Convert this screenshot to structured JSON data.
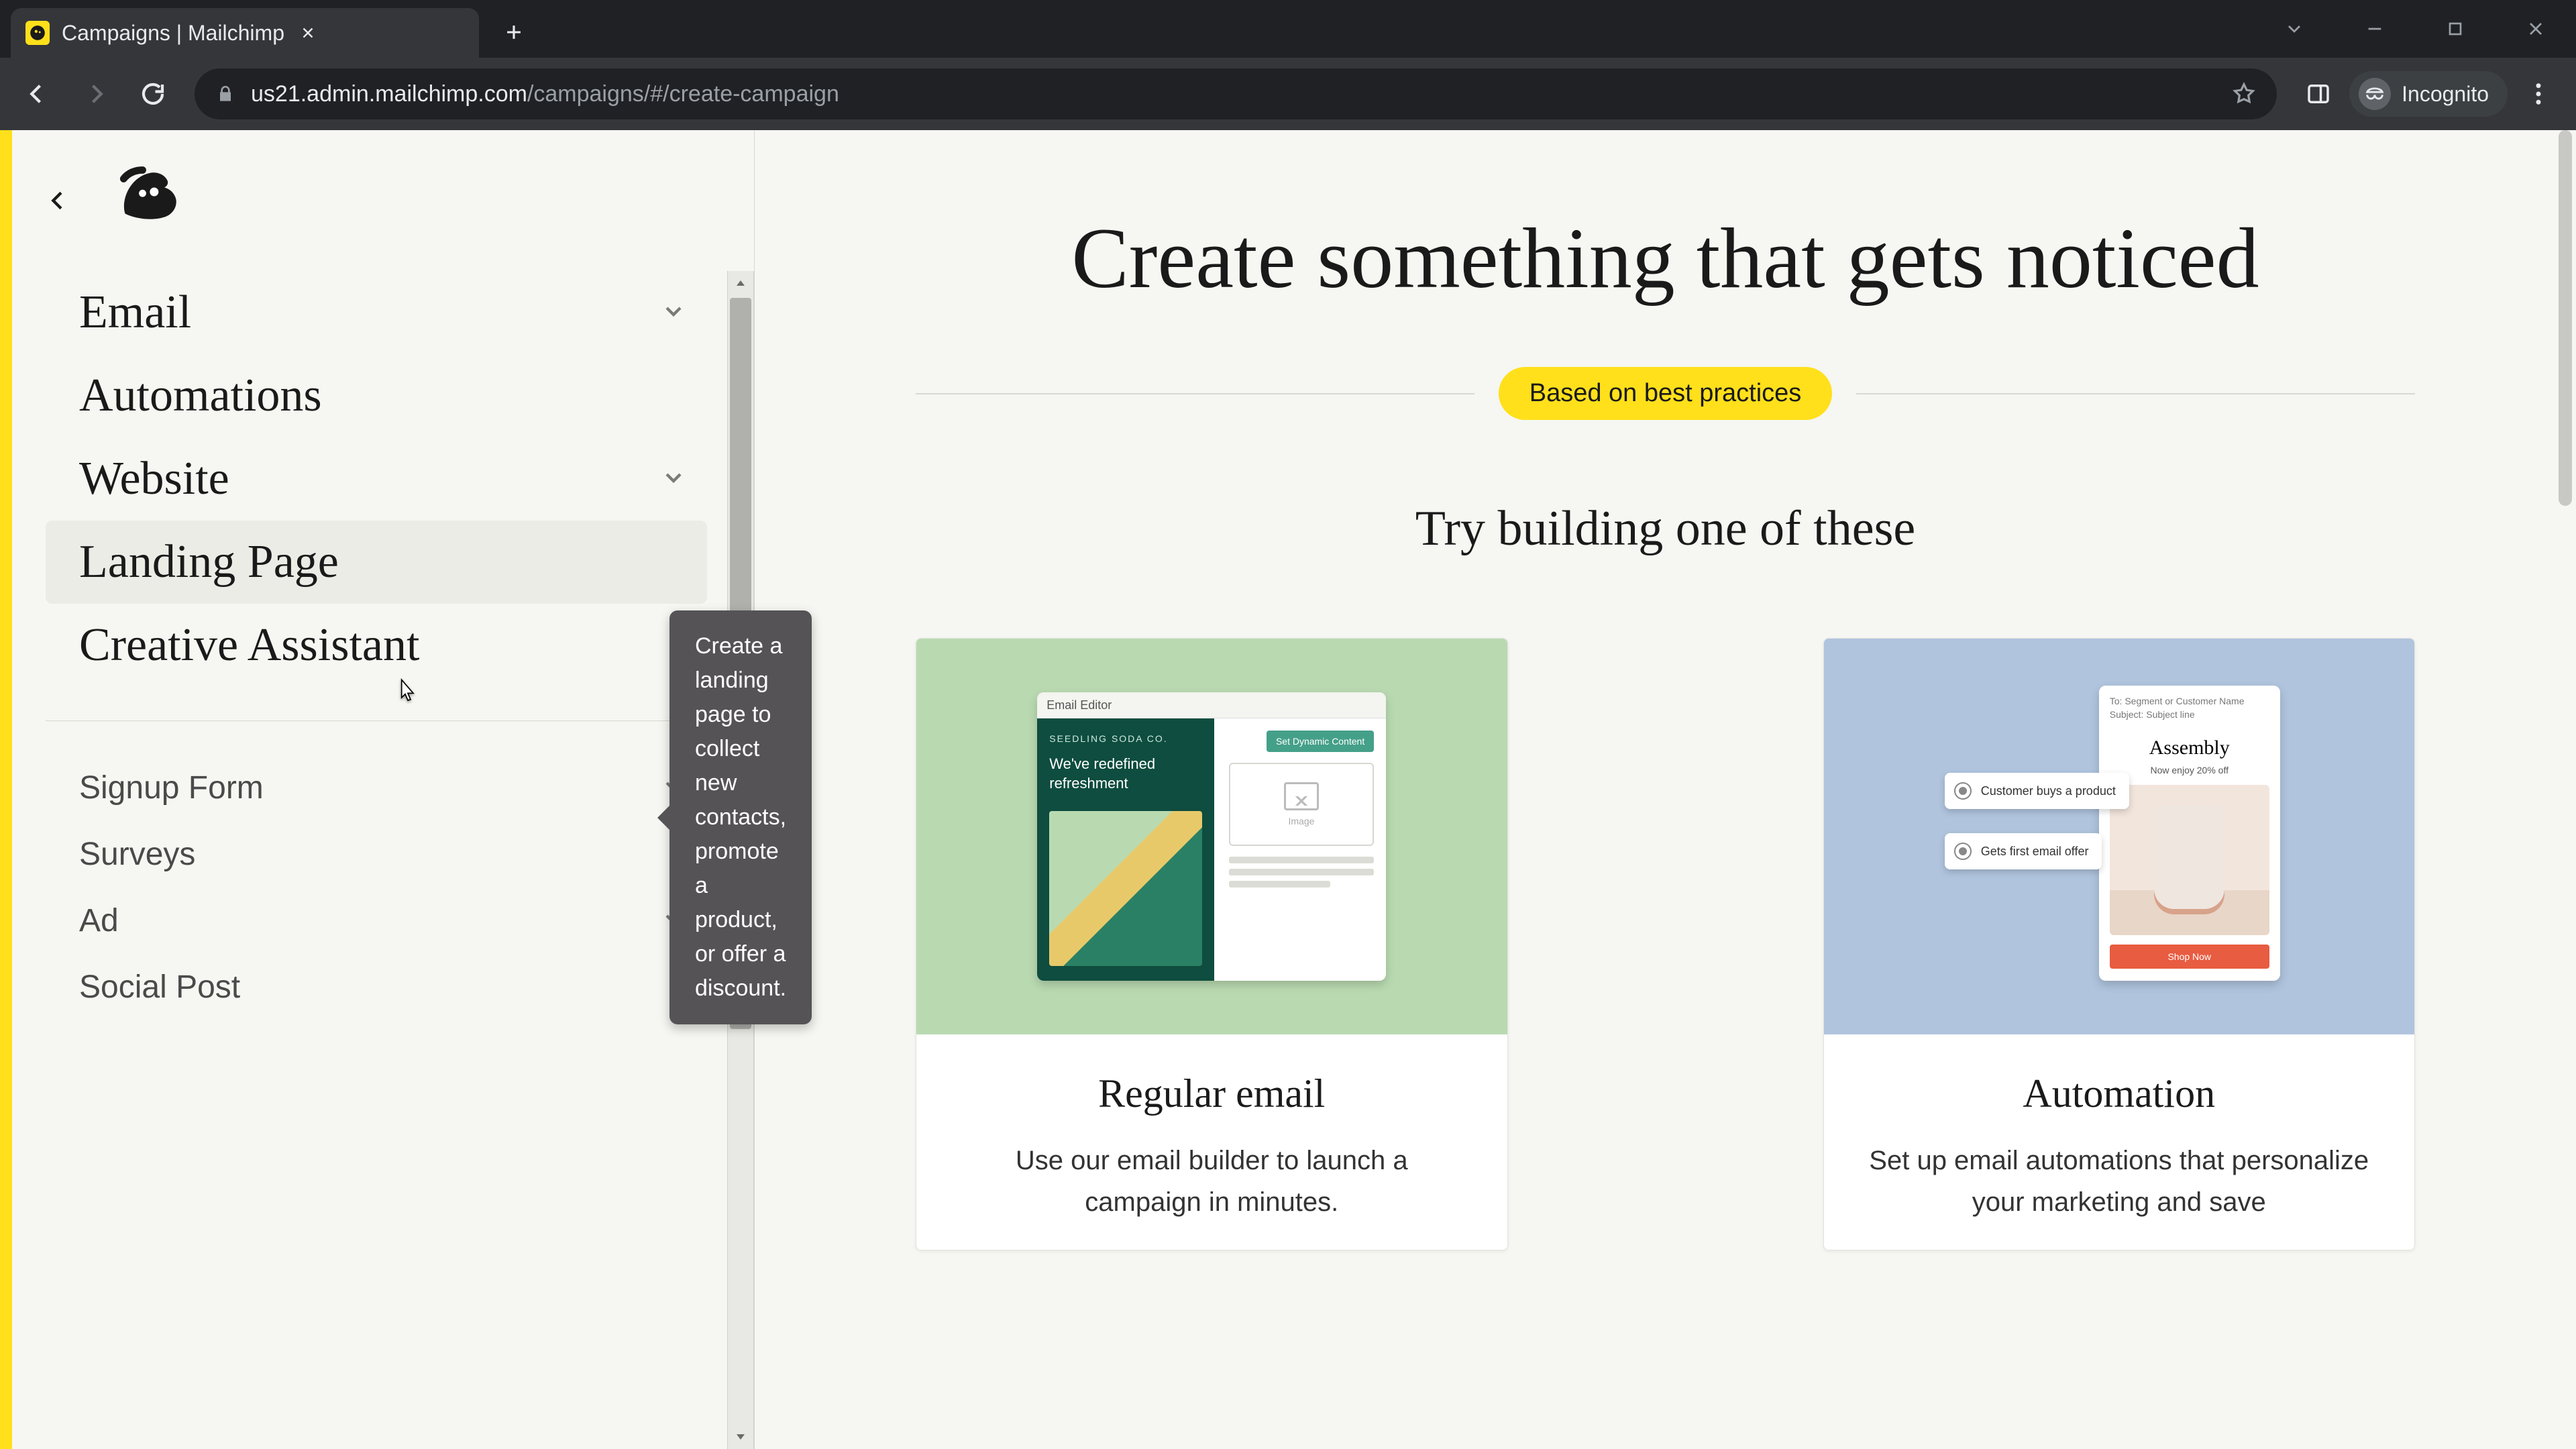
{
  "browser": {
    "tab_title": "Campaigns | Mailchimp",
    "url_host": "us21.admin.mailchimp.com",
    "url_path": "/campaigns/#/create-campaign",
    "incognito_label": "Incognito"
  },
  "sidebar": {
    "primary": [
      {
        "label": "Email",
        "expandable": true
      },
      {
        "label": "Automations",
        "expandable": false
      },
      {
        "label": "Website",
        "expandable": true
      },
      {
        "label": "Landing Page",
        "expandable": false,
        "hover": true
      },
      {
        "label": "Creative Assistant",
        "expandable": false
      }
    ],
    "secondary": [
      {
        "label": "Signup Form",
        "expandable": true
      },
      {
        "label": "Surveys",
        "expandable": false
      },
      {
        "label": "Ad",
        "expandable": true
      },
      {
        "label": "Social Post",
        "expandable": false
      }
    ]
  },
  "tooltip": {
    "text": "Create a landing page to collect new contacts, promote a product, or offer a discount."
  },
  "main": {
    "headline": "Create something that gets noticed",
    "pill": "Based on best practices",
    "subhead": "Try building one of these",
    "cards": [
      {
        "title": "Regular email",
        "desc": "Use our email builder to launch a campaign in minutes.",
        "mini": {
          "header": "Email Editor",
          "brand_tiny": "SEEDLING SODA CO.",
          "slogan": "We've redefined refreshment",
          "btn": "Set Dynamic Content",
          "placeholder_label": "Image"
        }
      },
      {
        "title": "Automation",
        "desc": "Set up email automations that personalize your marketing and save",
        "mini": {
          "hdr_line1": "To: Segment or Customer Name",
          "hdr_line2": "Subject: Subject line",
          "brand": "Assembly",
          "sub": "Now enjoy 20% off",
          "cta": "Shop Now",
          "chip1": "Customer buys a product",
          "chip2": "Gets first email offer"
        }
      }
    ]
  }
}
